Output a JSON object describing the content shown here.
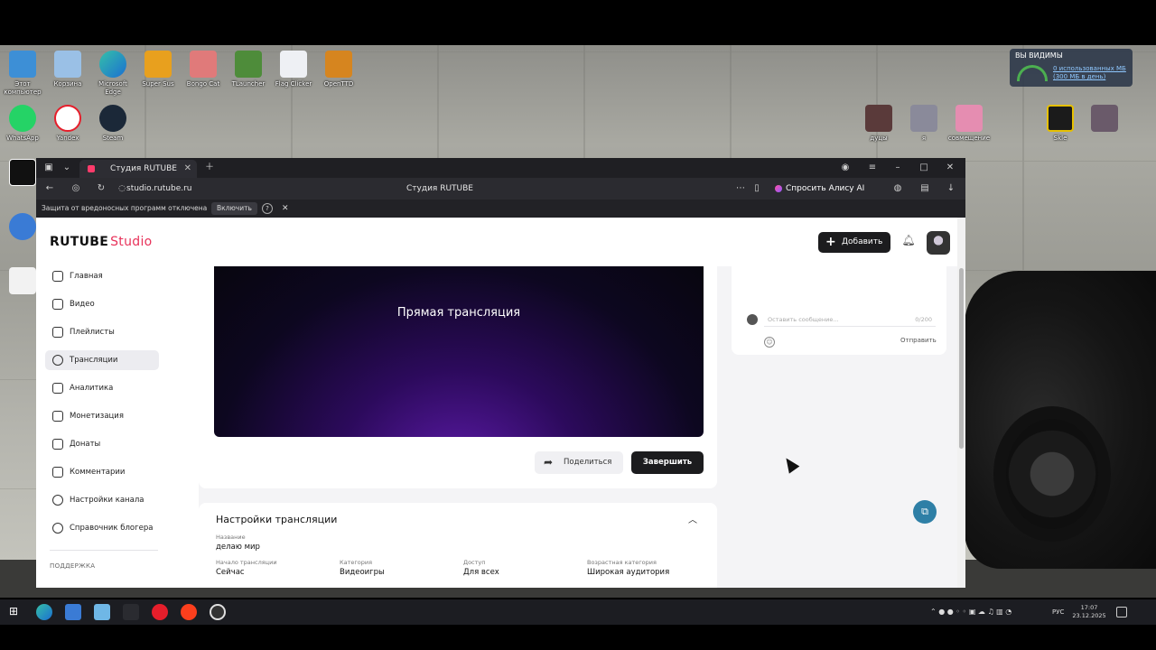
{
  "desktop": {
    "icons_row1": [
      "Этот компьютер",
      "Корзина",
      "Microsoft Edge",
      "Super Sus",
      "Bongo Cat",
      "TLauncher",
      "Flag Clicker",
      "OpenTTD"
    ],
    "icons_row2": [
      "WhatsApp",
      "Yandex",
      "Steam"
    ],
    "icons_right": [
      "дуцы",
      "я",
      "совмещение",
      "Skle",
      ""
    ],
    "widget_title": "ВЫ ВИДИМЫ",
    "widget_link": "0 использованных МБ (300 МБ в день)"
  },
  "browser": {
    "tab_title": "Студия RUTUBE",
    "url": "studio.rutube.ru",
    "page_title": "Студия RUTUBE",
    "alisa_label": "Спросить Алису AI",
    "warning_text": "Защита от вредоносных программ отключена",
    "warning_button": "Включить"
  },
  "studio": {
    "logo_main": "RUTUBE",
    "logo_sub": "Studio",
    "add_button": "Добавить",
    "nav": [
      {
        "label": "Главная"
      },
      {
        "label": "Видео"
      },
      {
        "label": "Плейлисты"
      },
      {
        "label": "Трансляции"
      },
      {
        "label": "Аналитика"
      },
      {
        "label": "Монетизация"
      },
      {
        "label": "Донаты"
      },
      {
        "label": "Комментарии"
      },
      {
        "label": "Настройки канала"
      },
      {
        "label": "Справочник блогера"
      }
    ],
    "support_label": "ПОДДЕРЖКА",
    "player_title": "Прямая трансляция",
    "share_button": "Поделиться",
    "finish_button": "Завершить",
    "settings_title": "Настройки трансляции",
    "fields": {
      "name_label": "Название",
      "name_value": "делаю мир",
      "start_label": "Начало трансляции",
      "start_value": "Сейчас",
      "category_label": "Категория",
      "category_value": "Видеоигры",
      "access_label": "Доступ",
      "access_value": "Для всех",
      "age_label": "Возрастная категория",
      "age_value": "Широкая аудитория"
    },
    "chat": {
      "placeholder": "Оставить сообщение...",
      "counter": "0/200",
      "send": "Отправить"
    }
  },
  "taskbar": {
    "lang": "РУС",
    "time": "17:07",
    "date": "23.12.2025"
  }
}
